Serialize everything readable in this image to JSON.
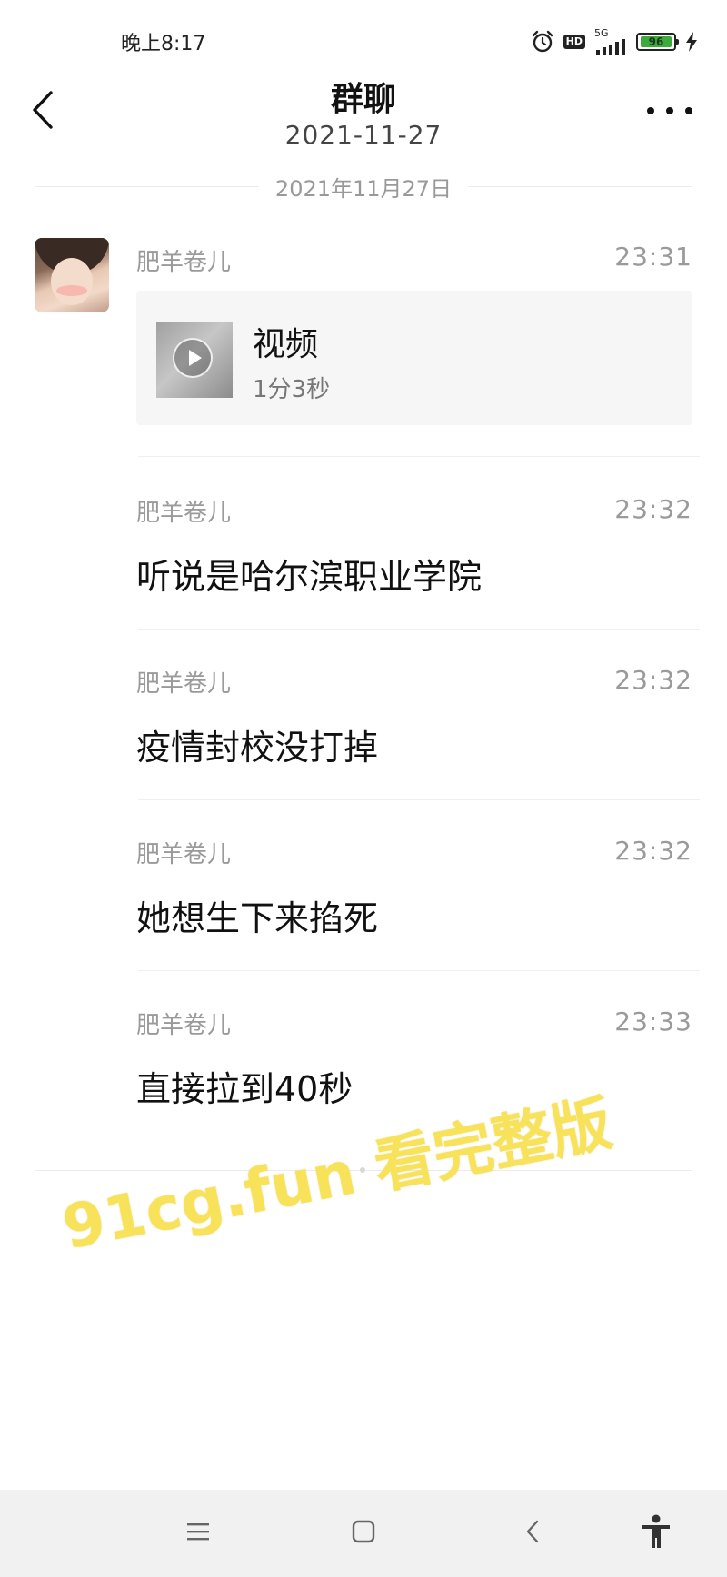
{
  "status_bar": {
    "time": "晚上8:17",
    "network": "5G",
    "hd": "HD",
    "battery": "96",
    "battery_level": 0.96
  },
  "header": {
    "title": "群聊",
    "date": "2021-11-27"
  },
  "date_divider": "2021年11月27日",
  "messages": [
    {
      "sender": "肥羊卷儿",
      "time": "23:31",
      "type": "video",
      "video_title": "视频",
      "video_duration": "1分3秒"
    },
    {
      "sender": "肥羊卷儿",
      "time": "23:32",
      "text": "听说是哈尔滨职业学院"
    },
    {
      "sender": "肥羊卷儿",
      "time": "23:32",
      "text": "疫情封校没打掉"
    },
    {
      "sender": "肥羊卷儿",
      "time": "23:32",
      "text": "她想生下来掐死"
    },
    {
      "sender": "肥羊卷儿",
      "time": "23:33",
      "text": "直接拉到40秒"
    }
  ],
  "watermark": "91cg.fun 看完整版",
  "icons": {
    "alarm": "alarm-icon",
    "signal": "signal-icon",
    "charging": "charging-icon",
    "back": "chevron-left-icon",
    "more": "more-icon",
    "menu": "menu-icon",
    "home": "home-icon",
    "nav_back": "back-icon",
    "accessibility": "accessibility-icon"
  },
  "colors": {
    "watermark": "#f7e25a",
    "battery": "#3daa3d",
    "secondary_text": "#9a9a9a"
  }
}
